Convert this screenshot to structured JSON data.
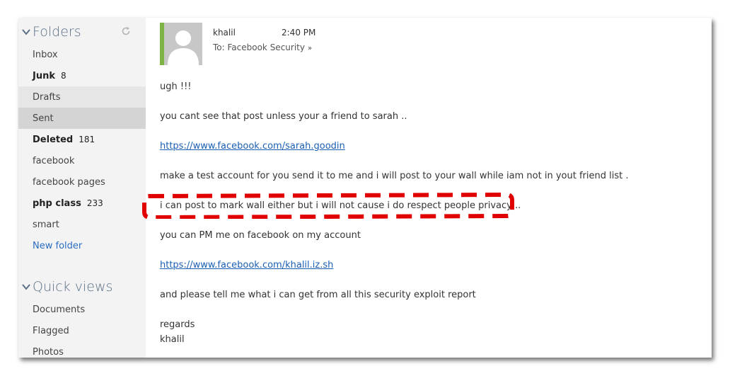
{
  "sidebar": {
    "folders_header": "Folders",
    "folders": [
      {
        "label": "Inbox",
        "count": ""
      },
      {
        "label": "Junk",
        "count": "8"
      },
      {
        "label": "Drafts",
        "count": ""
      },
      {
        "label": "Sent",
        "count": ""
      },
      {
        "label": "Deleted",
        "count": "181"
      },
      {
        "label": "facebook",
        "count": ""
      },
      {
        "label": "facebook pages",
        "count": ""
      },
      {
        "label": "php class",
        "count": "233"
      },
      {
        "label": "smart",
        "count": ""
      }
    ],
    "new_folder": "New folder",
    "quick_views_header": "Quick views",
    "quick_views": [
      {
        "label": "Documents"
      },
      {
        "label": "Flagged"
      },
      {
        "label": "Photos"
      }
    ]
  },
  "message": {
    "sender": "khalil",
    "time": "2:40 PM",
    "to": "To: Facebook Security",
    "lines": [
      "ugh !!!",
      "you cant see that post unless your a friend to sarah ..",
      "https://www.facebook.com/sarah.goodin",
      "make a test account for you send it to me and i will post to your wall while iam not in yout friend list .",
      "i can post to mark wall either but i will not cause i do respect people privacy ..",
      "you can PM me on facebook on my account",
      "https://www.facebook.com/khalil.iz.sh",
      "and please tell me what i can get from all this security exploit report",
      "regards",
      "khalil"
    ]
  },
  "colors": {
    "avatar_accent": "#7cb342",
    "highlight_dash": "#e00000",
    "link": "#1a5fb4"
  }
}
